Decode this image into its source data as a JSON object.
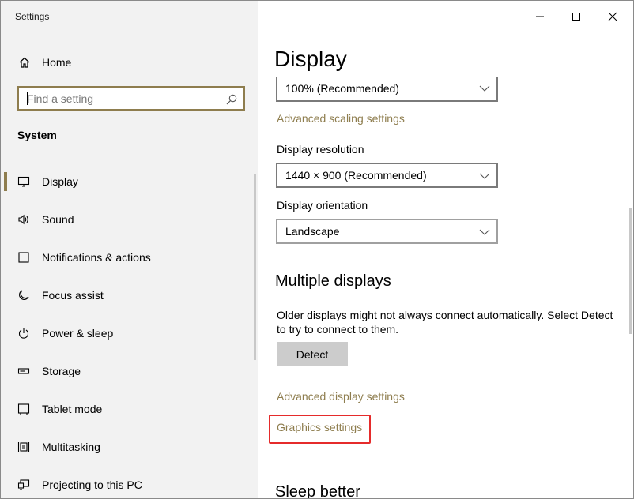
{
  "window": {
    "title": "Settings"
  },
  "sidebar": {
    "home_label": "Home",
    "search_placeholder": "Find a setting",
    "section_label": "System",
    "items": [
      {
        "label": "Display",
        "icon": "monitor-icon",
        "active": true
      },
      {
        "label": "Sound",
        "icon": "speaker-icon"
      },
      {
        "label": "Notifications & actions",
        "icon": "notification-icon"
      },
      {
        "label": "Focus assist",
        "icon": "moon-icon"
      },
      {
        "label": "Power & sleep",
        "icon": "power-icon"
      },
      {
        "label": "Storage",
        "icon": "storage-icon"
      },
      {
        "label": "Tablet mode",
        "icon": "tablet-icon"
      },
      {
        "label": "Multitasking",
        "icon": "multitasking-icon"
      },
      {
        "label": "Projecting to this PC",
        "icon": "projector-icon"
      }
    ]
  },
  "main": {
    "title": "Display",
    "scale_value": "100% (Recommended)",
    "advanced_scaling_link": "Advanced scaling settings",
    "resolution_label": "Display resolution",
    "resolution_value": "1440 × 900 (Recommended)",
    "orientation_label": "Display orientation",
    "orientation_value": "Landscape",
    "multiple_displays_title": "Multiple displays",
    "multiple_displays_desc": "Older displays might not always connect automatically. Select Detect to try to connect to them.",
    "detect_button": "Detect",
    "advanced_display_link": "Advanced display settings",
    "graphics_link": "Graphics settings",
    "sleep_title": "Sleep better"
  },
  "colors": {
    "accent": "#8e7d4e",
    "highlight": "#e52b2b",
    "sidebar_bg": "#f2f2f2"
  }
}
